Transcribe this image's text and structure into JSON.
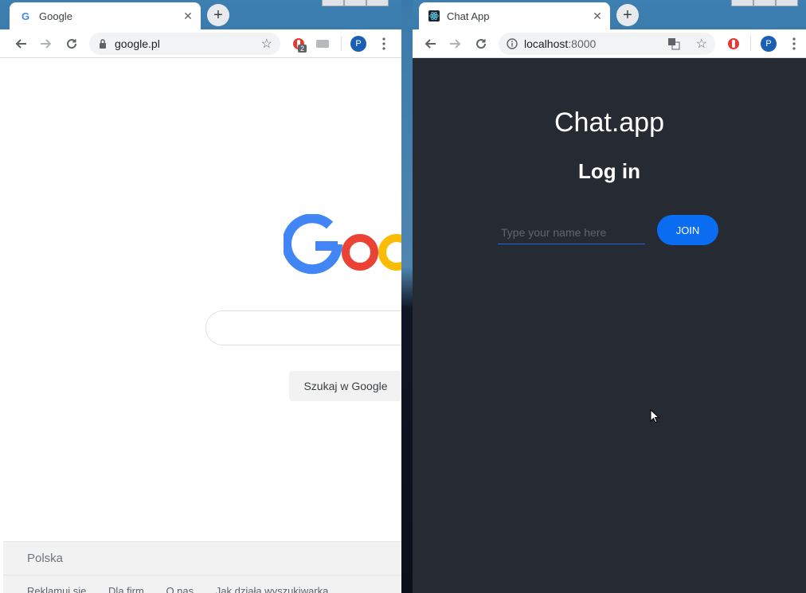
{
  "left_window": {
    "tab": {
      "title": "Google"
    },
    "address": "google.pl",
    "extension_badge": "2",
    "profile_initial": "P",
    "page": {
      "search_button": "Szukaj w Google",
      "footer": {
        "country": "Polska",
        "links": [
          "Reklamuj się",
          "Dla firm",
          "O nas",
          "Jak działa wyszukiwarka"
        ]
      }
    }
  },
  "right_window": {
    "tab": {
      "title": "Chat App"
    },
    "address_host": "localhost",
    "address_port": ":8000",
    "profile_initial": "P",
    "page": {
      "app_title": "Chat.app",
      "subtitle": "Log in",
      "name_placeholder": "Type your name here",
      "join_label": "JOIN"
    }
  },
  "colors": {
    "chat_bg": "#262a33",
    "accent": "#0a6cf0",
    "google_blue": "#4285f4",
    "google_red": "#ea4335",
    "google_yellow": "#fbbc05"
  }
}
